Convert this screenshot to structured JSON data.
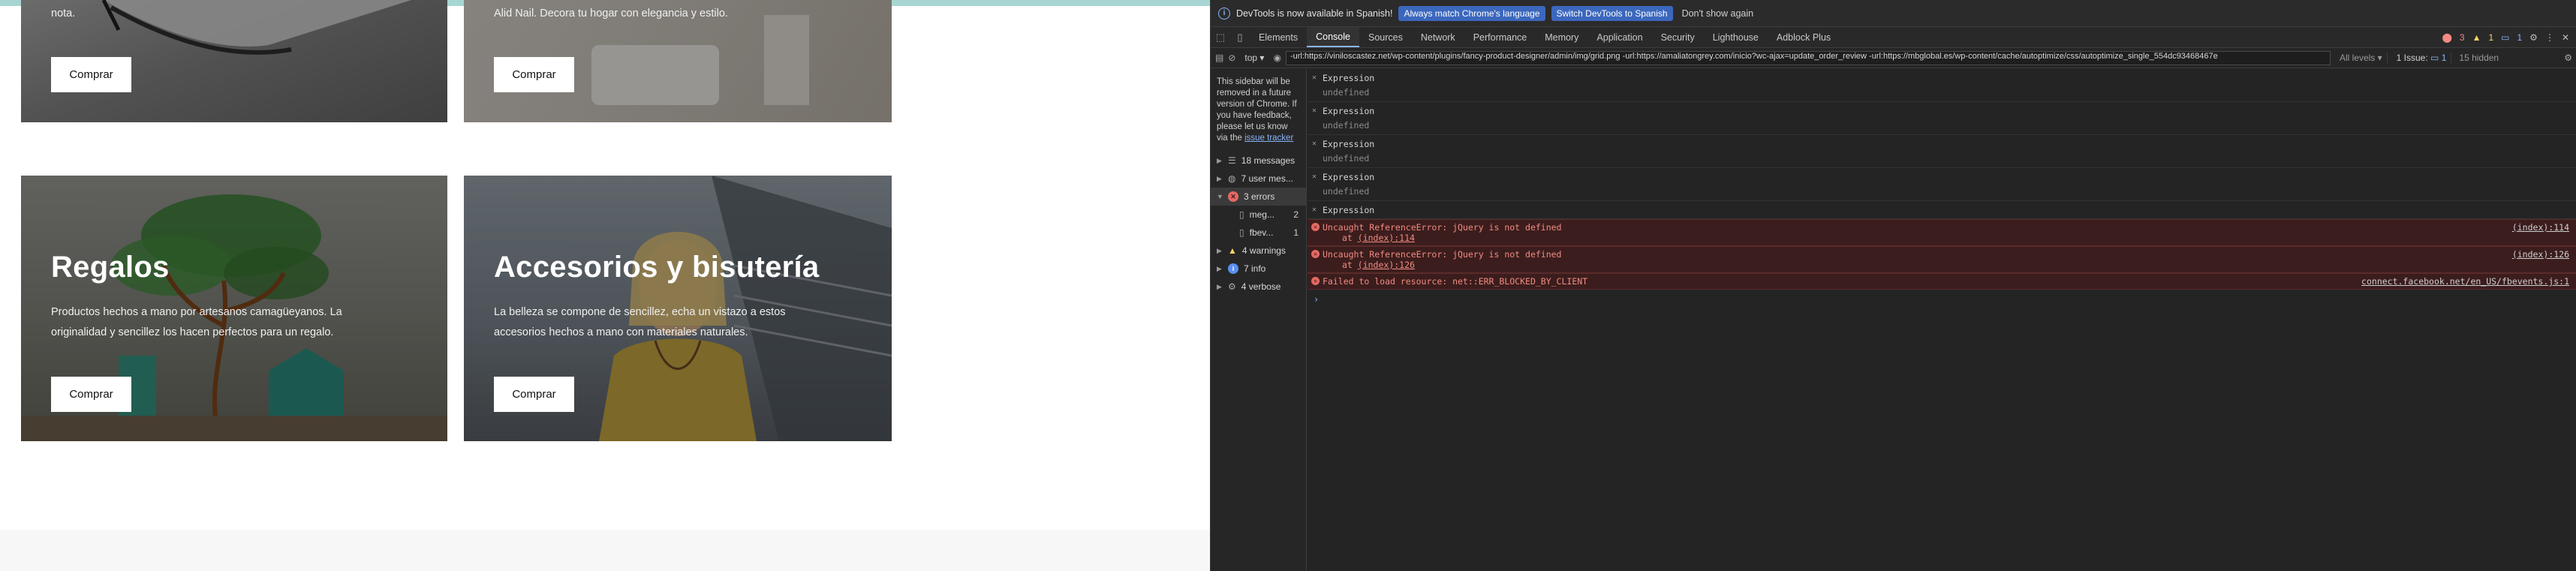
{
  "site": {
    "cards": [
      {
        "id": "top-left",
        "desc": "nota.",
        "button": "Comprar"
      },
      {
        "id": "top-right",
        "desc": "Alid Nail. Decora tu hogar con elegancia y estilo.",
        "button": "Comprar"
      },
      {
        "id": "regalos",
        "title": "Regalos",
        "desc_line1": "Productos hechos a mano por artesanos camagüeyanos. La",
        "desc_line2": "originalidad y sencillez los hacen perfectos para un regalo.",
        "button": "Comprar"
      },
      {
        "id": "accesorios",
        "title": "Accesorios y bisutería",
        "desc_line1": "La belleza se compone de sencillez, echa un vistazo a estos",
        "desc_line2": "accesorios hechos a mano con materiales naturales.",
        "button": "Comprar"
      }
    ]
  },
  "devtools": {
    "infobar": {
      "message": "DevTools is now available in Spanish!",
      "btn_match": "Always match Chrome's language",
      "btn_switch": "Switch DevTools to Spanish",
      "dont_show": "Don't show again"
    },
    "tabs": [
      "Elements",
      "Console",
      "Sources",
      "Network",
      "Performance",
      "Memory",
      "Application",
      "Security",
      "Lighthouse",
      "Adblock Plus"
    ],
    "active_tab": "Console",
    "counts": {
      "errors": "3",
      "warnings": "1",
      "messages": "1"
    },
    "filter": {
      "context": "top",
      "value": "-url:https://viniloscastez.net/wp-content/plugins/fancy-product-designer/admin/img/grid.png -url:https://amaliatongrey.com/inicio?wc-ajax=update_order_review -url:https://mbglobal.es/wp-content/cache/autoptimize/css/autoptimize_single_554dc93468467e",
      "levels": "All levels",
      "issues": "1 Issue:",
      "issues_count": "1",
      "hidden": "15 hidden"
    },
    "sidebar": {
      "note": "This sidebar will be removed in a future version of Chrome. If you have feedback, please let us know via the",
      "note_link": "issue tracker",
      "items": [
        {
          "label": "18 messages"
        },
        {
          "label": "7 user mes..."
        },
        {
          "label": "3 errors"
        },
        {
          "label": "meg...",
          "count": "2"
        },
        {
          "label": "fbev...",
          "count": "1"
        },
        {
          "label": "4 warnings"
        },
        {
          "label": "7 info"
        },
        {
          "label": "4 verbose"
        }
      ]
    },
    "console": {
      "expressions": [
        {
          "label": "Expression",
          "value": "undefined"
        },
        {
          "label": "Expression",
          "value": "undefined"
        },
        {
          "label": "Expression",
          "value": "undefined"
        },
        {
          "label": "Expression",
          "value": "undefined"
        },
        {
          "label": "Expression"
        }
      ],
      "errors": [
        {
          "message": "Uncaught ReferenceError: jQuery is not defined",
          "at": "at ",
          "at_link": "(index):114",
          "source": "(index):114"
        },
        {
          "message": "Uncaught ReferenceError: jQuery is not defined",
          "at": "at ",
          "at_link": "(index):126",
          "source": "(index):126"
        },
        {
          "message": "Failed to load resource: net::ERR_BLOCKED_BY_CLIENT",
          "source": "connect.facebook.net/en_US/fbevents.js:1"
        }
      ],
      "prompt": "›"
    }
  }
}
